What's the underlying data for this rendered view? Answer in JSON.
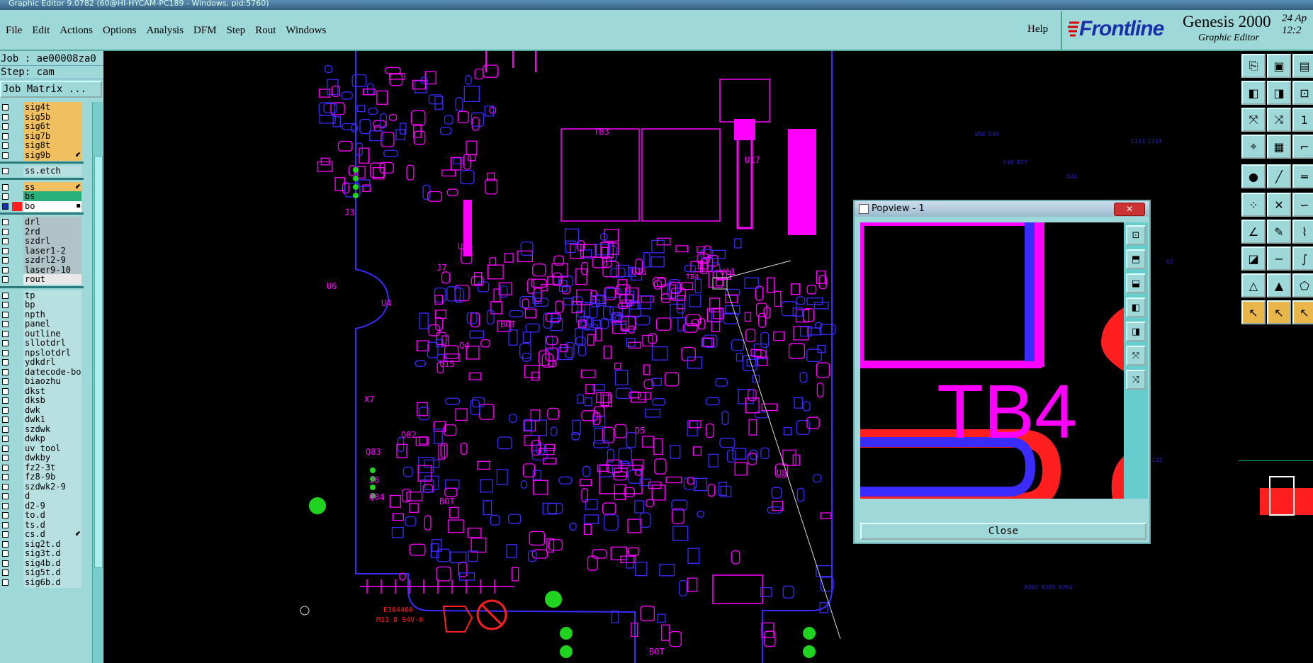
{
  "window": {
    "title": "Graphic Editor 9.0782 (60@HI-HYCAM-PC189 - Windows, pid:5760)"
  },
  "menu": {
    "items": [
      {
        "label": "File"
      },
      {
        "label": "Edit"
      },
      {
        "label": "Actions"
      },
      {
        "label": "Options"
      },
      {
        "label": "Analysis"
      },
      {
        "label": "DFM"
      },
      {
        "label": "Step"
      },
      {
        "label": "Rout"
      },
      {
        "label": "Windows"
      }
    ],
    "help": "Help"
  },
  "brand": {
    "name": "Frontline",
    "product": "Genesis 2000",
    "subtitle": "Graphic Editor",
    "date_line1": "24 Ap",
    "date_line2": "12:2"
  },
  "job": {
    "job_line": "Job : ae00008za0",
    "step_line": "Step: cam",
    "job_matrix": "Job Matrix ..."
  },
  "layers": [
    {
      "name": "sig4t",
      "color": "#f0c060",
      "flag": ""
    },
    {
      "name": "sig5b",
      "color": "#f0c060",
      "flag": ""
    },
    {
      "name": "sig6t",
      "color": "#f0c060",
      "flag": ""
    },
    {
      "name": "sig7b",
      "color": "#f0c060",
      "flag": ""
    },
    {
      "name": "sig8t",
      "color": "#f0c060",
      "flag": ""
    },
    {
      "name": "sig9b",
      "color": "#f0c060",
      "flag": "⬋"
    },
    {
      "sep": true
    },
    {
      "name": "ss.etch",
      "color": "#b8e0e0",
      "flag": ""
    },
    {
      "sep": true
    },
    {
      "name": "ss",
      "color": "#f0c060",
      "flag": "⬋"
    },
    {
      "name": "bs",
      "color": "#2ab07a",
      "flag": ""
    },
    {
      "name": "bo",
      "color": "#ffffff",
      "flag": "▪",
      "active": true
    },
    {
      "sep": true
    },
    {
      "name": "drl",
      "color": "#b0c4c8",
      "flag": ""
    },
    {
      "name": "2rd",
      "color": "#b0c4c8",
      "flag": ""
    },
    {
      "name": "szdrl",
      "color": "#b0c4c8",
      "flag": ""
    },
    {
      "name": "laser1-2",
      "color": "#b0c4c8",
      "flag": ""
    },
    {
      "name": "szdrl2-9",
      "color": "#b0c4c8",
      "flag": ""
    },
    {
      "name": "laser9-10",
      "color": "#b0c4c8",
      "flag": ""
    },
    {
      "name": "rout",
      "color": "#e8e8e8",
      "flag": ""
    },
    {
      "sep": true
    },
    {
      "name": "tp",
      "color": "#b8e0e0",
      "flag": ""
    },
    {
      "name": "bp",
      "color": "#b8e0e0",
      "flag": ""
    },
    {
      "name": "npth",
      "color": "#b8e0e0",
      "flag": ""
    },
    {
      "name": "panel",
      "color": "#b8e0e0",
      "flag": ""
    },
    {
      "name": "outline",
      "color": "#b8e0e0",
      "flag": ""
    },
    {
      "name": "sllotdrl",
      "color": "#b8e0e0",
      "flag": ""
    },
    {
      "name": "npslotdrl",
      "color": "#b8e0e0",
      "flag": ""
    },
    {
      "name": "ydkdrl",
      "color": "#b8e0e0",
      "flag": ""
    },
    {
      "name": "datecode-bo",
      "color": "#b8e0e0",
      "flag": ""
    },
    {
      "name": "biaozhu",
      "color": "#b8e0e0",
      "flag": ""
    },
    {
      "name": "dkst",
      "color": "#b8e0e0",
      "flag": ""
    },
    {
      "name": "dksb",
      "color": "#b8e0e0",
      "flag": ""
    },
    {
      "name": "dwk",
      "color": "#b8e0e0",
      "flag": ""
    },
    {
      "name": "dwk1",
      "color": "#b8e0e0",
      "flag": ""
    },
    {
      "name": "szdwk",
      "color": "#b8e0e0",
      "flag": ""
    },
    {
      "name": "dwkp",
      "color": "#b8e0e0",
      "flag": ""
    },
    {
      "name": "uv_tool",
      "color": "#b8e0e0",
      "flag": ""
    },
    {
      "name": "dwkby",
      "color": "#b8e0e0",
      "flag": ""
    },
    {
      "name": "fz2-3t",
      "color": "#b8e0e0",
      "flag": ""
    },
    {
      "name": "fz8-9b",
      "color": "#b8e0e0",
      "flag": ""
    },
    {
      "name": "szdwk2-9",
      "color": "#b8e0e0",
      "flag": ""
    },
    {
      "name": "d",
      "color": "#b8e0e0",
      "flag": ""
    },
    {
      "name": "d2-9",
      "color": "#b8e0e0",
      "flag": ""
    },
    {
      "name": "to.d",
      "color": "#b8e0e0",
      "flag": ""
    },
    {
      "name": "ts.d",
      "color": "#b8e0e0",
      "flag": ""
    },
    {
      "name": "cs.d",
      "color": "#b8e0e0",
      "flag": "⬋"
    },
    {
      "name": "sig2t.d",
      "color": "#b8e0e0",
      "flag": ""
    },
    {
      "name": "sig3t.d",
      "color": "#b8e0e0",
      "flag": ""
    },
    {
      "name": "sig4b.d",
      "color": "#b8e0e0",
      "flag": ""
    },
    {
      "name": "sig5t.d",
      "color": "#b8e0e0",
      "flag": ""
    },
    {
      "name": "sig6b.d",
      "color": "#b8e0e0",
      "flag": ""
    }
  ],
  "board_labels": {
    "tb3": "TB3",
    "u17": "U17",
    "u14": "U14",
    "u11": "U11",
    "u16": "U16",
    "u6": "U6",
    "u4": "U4",
    "q4": "Q4",
    "q15": "Q15",
    "x7": "X7",
    "d5": "D5",
    "u8": "U8",
    "q82": "Q82",
    "q83": "Q83",
    "q84": "Q84",
    "j8": "J8",
    "j3": "J3",
    "j7": "J7",
    "bot1": "BOT",
    "bot2": "BOT",
    "bot3": "BOT",
    "tb4": "TB4",
    "code": "E304460",
    "code2": "M11 8 94V-0"
  },
  "popview": {
    "title": "Popview - 1",
    "close": "Close",
    "zoom_label": "TB4"
  },
  "colors": {
    "panel": "#9fd8d8",
    "accent": "#ff00ff",
    "blue": "#3a2cff",
    "red": "#ff1f1f",
    "green": "#1fd31f"
  }
}
